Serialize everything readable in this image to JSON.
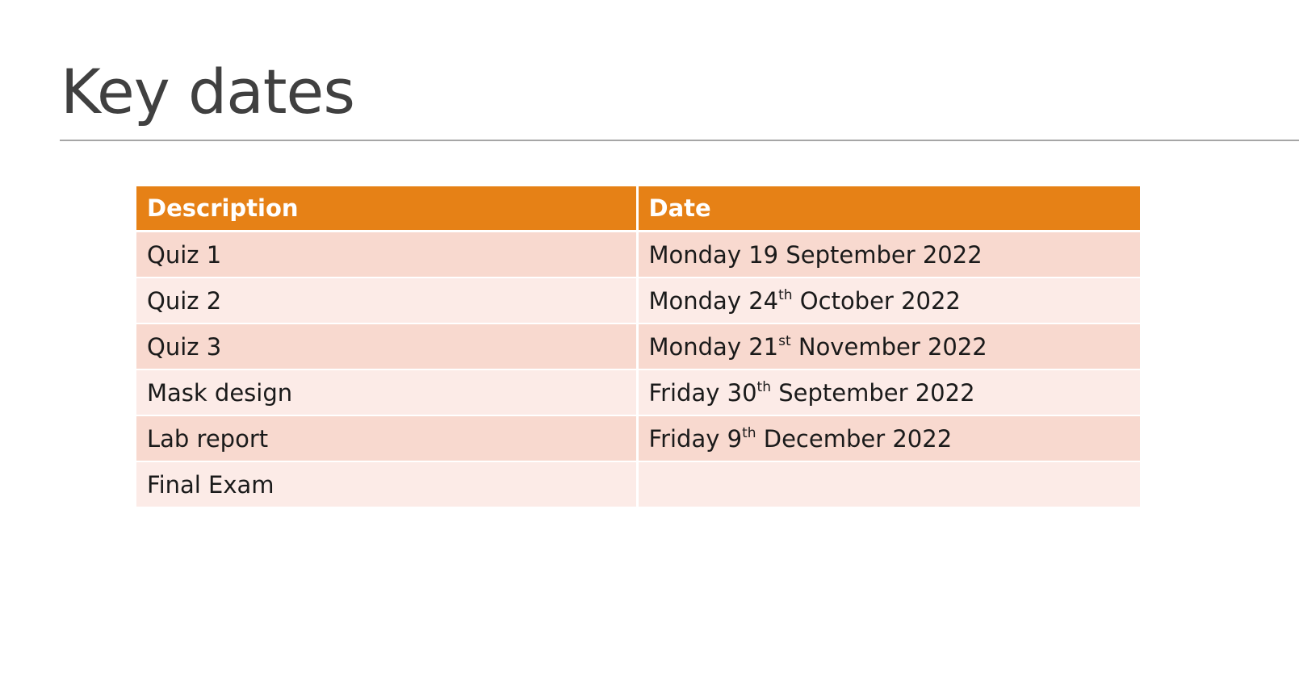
{
  "slide": {
    "title": "Key dates"
  },
  "table": {
    "headers": [
      "Description",
      "Date"
    ],
    "rows": [
      {
        "description": "Quiz 1",
        "day": "Monday",
        "num": "19",
        "suffix": "",
        "rest": "September 2022"
      },
      {
        "description": "Quiz 2",
        "day": "Monday",
        "num": "24",
        "suffix": "th",
        "rest": "October 2022"
      },
      {
        "description": "Quiz 3",
        "day": "Monday",
        "num": "21",
        "suffix": "st",
        "rest": "November 2022"
      },
      {
        "description": "Mask design",
        "day": "Friday",
        "num": "30",
        "suffix": "th",
        "rest": "September 2022"
      },
      {
        "description": "Lab report",
        "day": "Friday",
        "num": "9",
        "suffix": "th",
        "rest": "December 2022"
      },
      {
        "description": "Final Exam",
        "day": "",
        "num": "",
        "suffix": "",
        "rest": ""
      }
    ]
  },
  "colors": {
    "header": "#e68116",
    "row_odd": "#f8d9cf",
    "row_even": "#fcebe7",
    "title_text": "#404040",
    "rule": "#a6a6a6"
  }
}
